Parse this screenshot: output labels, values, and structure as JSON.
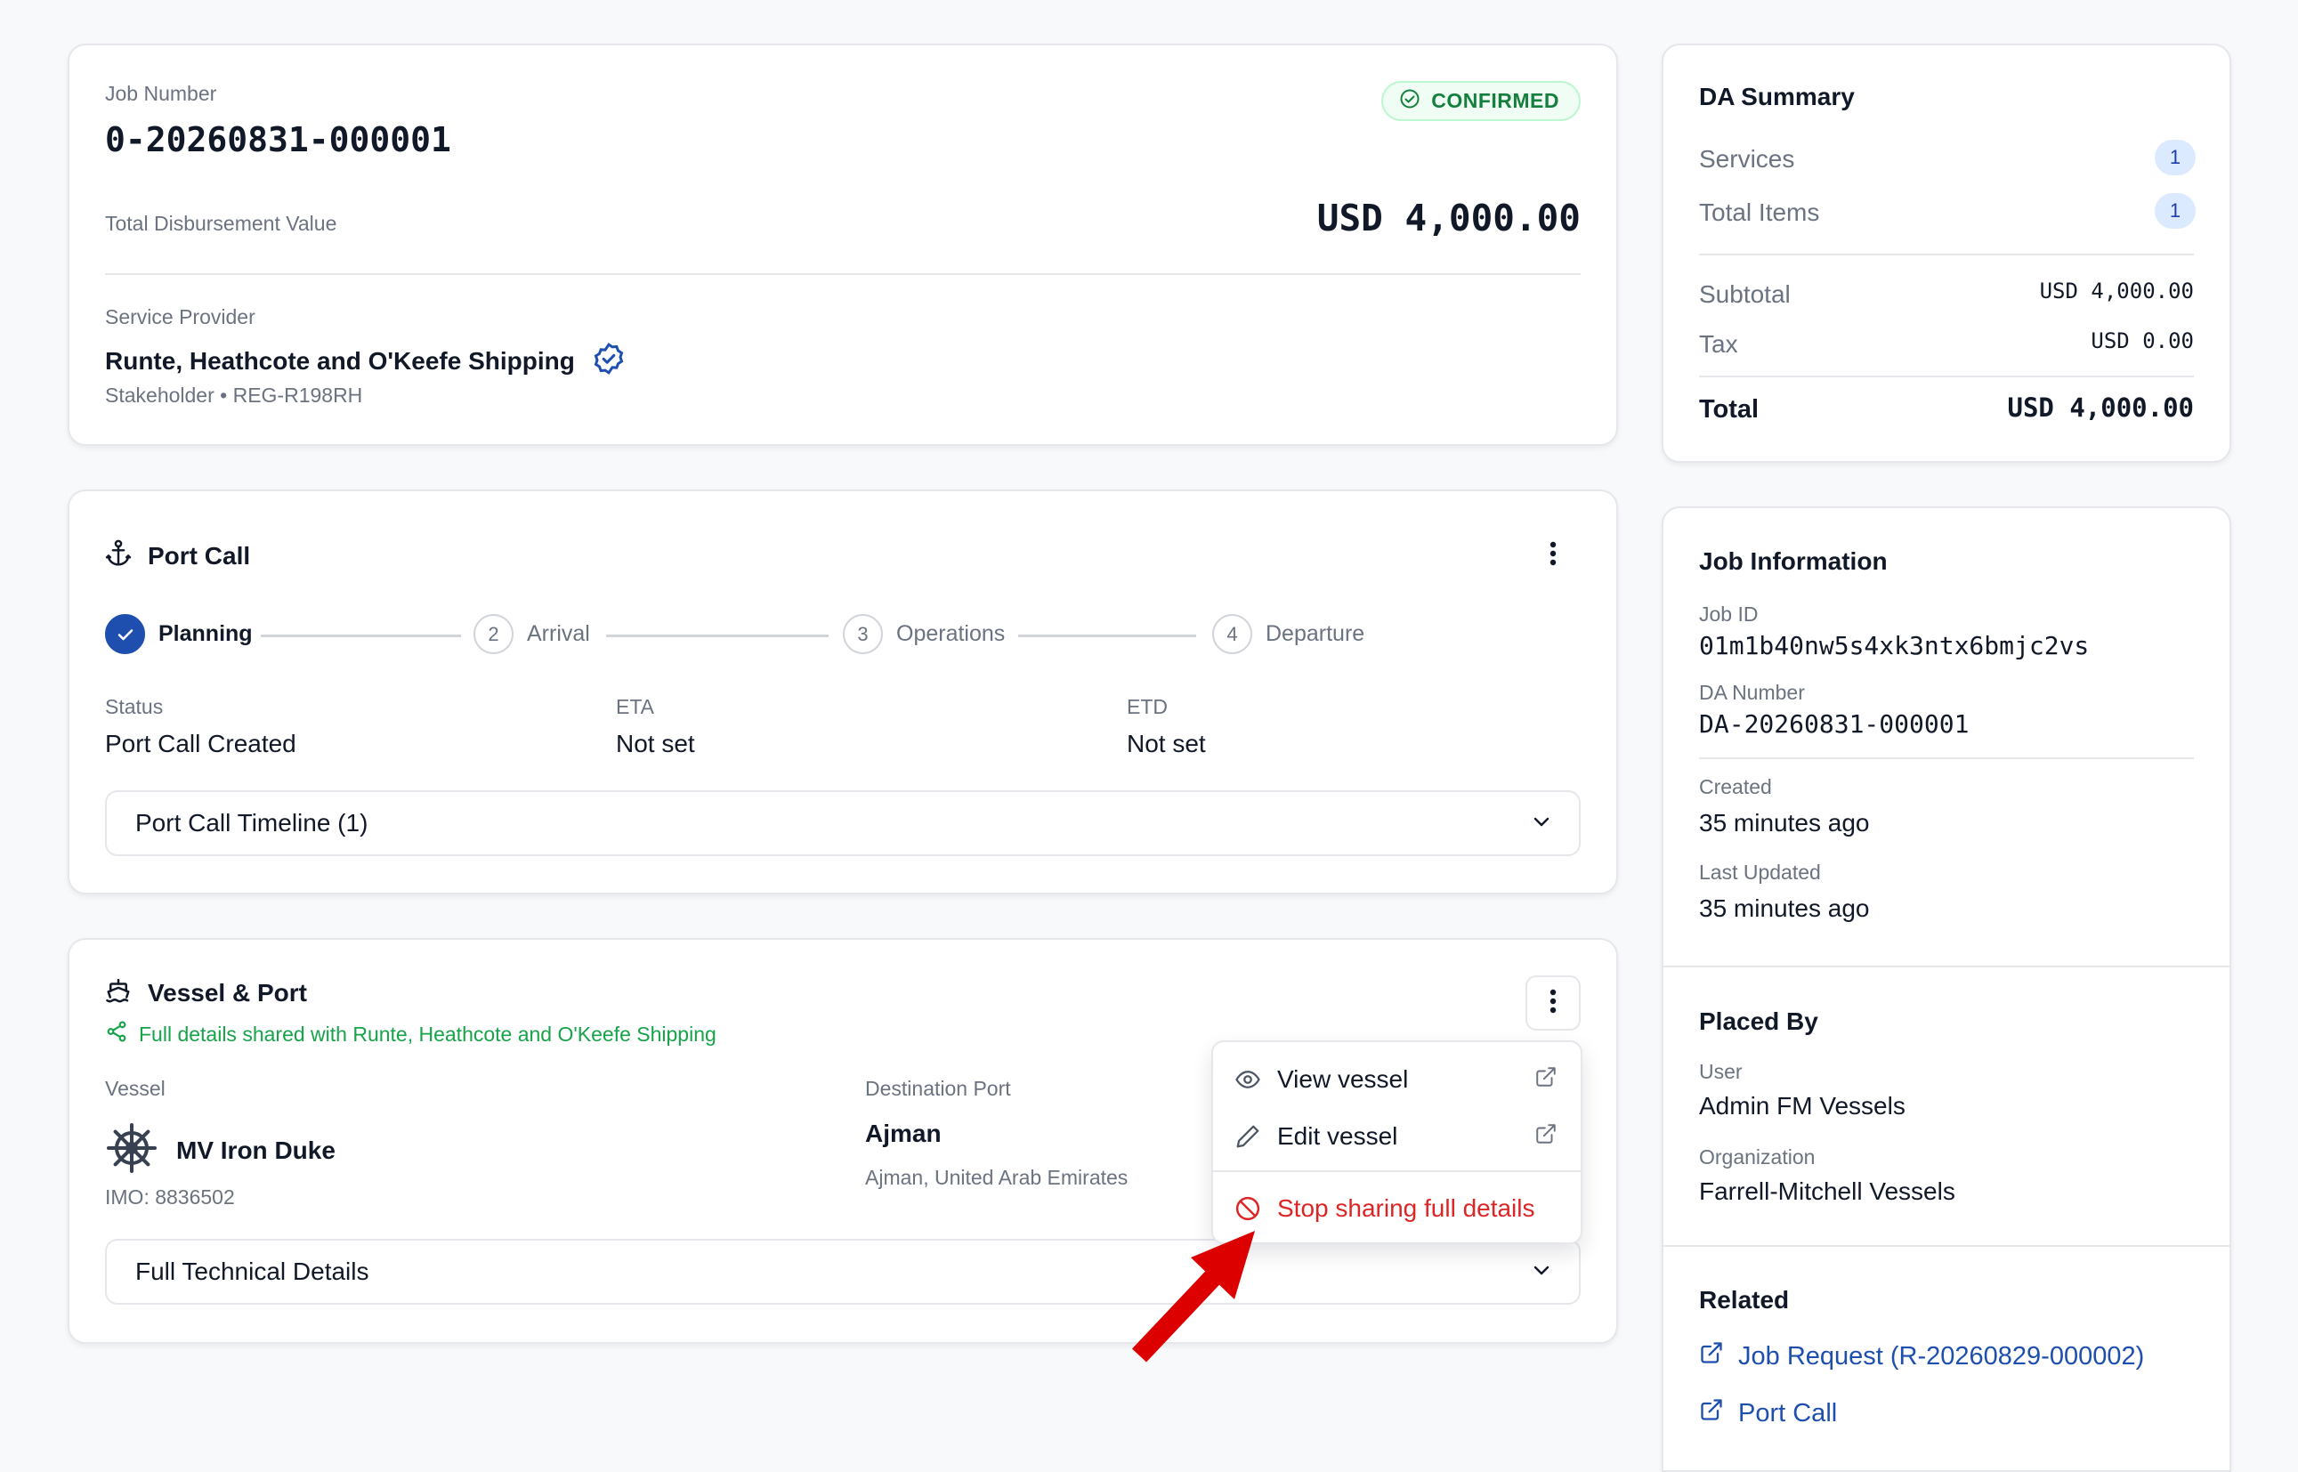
{
  "job": {
    "number_label": "Job Number",
    "number": "0-20260831-000001",
    "status": "CONFIRMED",
    "total_label": "Total Disbursement Value",
    "total_value": "USD 4,000.00",
    "provider_label": "Service Provider",
    "provider_name": "Runte, Heathcote and O'Keefe Shipping",
    "provider_meta": "Stakeholder • REG-R198RH"
  },
  "port_call": {
    "title": "Port Call",
    "steps": [
      {
        "num": "",
        "label": "Planning",
        "done": true
      },
      {
        "num": "2",
        "label": "Arrival",
        "done": false
      },
      {
        "num": "3",
        "label": "Operations",
        "done": false
      },
      {
        "num": "4",
        "label": "Departure",
        "done": false
      }
    ],
    "fields": [
      {
        "label": "Status",
        "value": "Port Call Created"
      },
      {
        "label": "ETA",
        "value": "Not set"
      },
      {
        "label": "ETD",
        "value": "Not set"
      }
    ],
    "timeline_label": "Port Call Timeline (1)"
  },
  "vessel_port": {
    "title": "Vessel & Port",
    "shared_note": "Full details shared with Runte, Heathcote and O'Keefe Shipping",
    "vessel_label": "Vessel",
    "vessel_name": "MV Iron Duke",
    "imo": "IMO: 8836502",
    "dest_label": "Destination Port",
    "dest_name": "Ajman",
    "dest_location": "Ajman, United Arab Emirates",
    "technical_label": "Full Technical Details",
    "menu": {
      "view": "View vessel",
      "edit": "Edit vessel",
      "stop": "Stop sharing full details"
    }
  },
  "summary": {
    "title": "DA Summary",
    "services_label": "Services",
    "services_count": "1",
    "items_label": "Total Items",
    "items_count": "1",
    "subtotal_label": "Subtotal",
    "subtotal_value": "USD 4,000.00",
    "tax_label": "Tax",
    "tax_value": "USD 0.00",
    "total_label": "Total",
    "total_value": "USD 4,000.00"
  },
  "job_info": {
    "title": "Job Information",
    "job_id_label": "Job ID",
    "job_id": "01m1b40nw5s4xk3ntx6bmjc2vs",
    "da_label": "DA Number",
    "da_number": "DA-20260831-000001",
    "created_label": "Created",
    "created_value": "35 minutes ago",
    "updated_label": "Last Updated",
    "updated_value": "35 minutes ago"
  },
  "placed_by": {
    "title": "Placed By",
    "user_label": "User",
    "user_value": "Admin FM Vessels",
    "org_label": "Organization",
    "org_value": "Farrell-Mitchell Vessels"
  },
  "related": {
    "title": "Related",
    "job_request": "Job Request (R-20260829-000002)",
    "port_call": "Port Call"
  },
  "colors": {
    "primary": "#1e4fae",
    "success": "#15803d",
    "danger": "#dc2626",
    "annotation_arrow": "#dc0000"
  }
}
